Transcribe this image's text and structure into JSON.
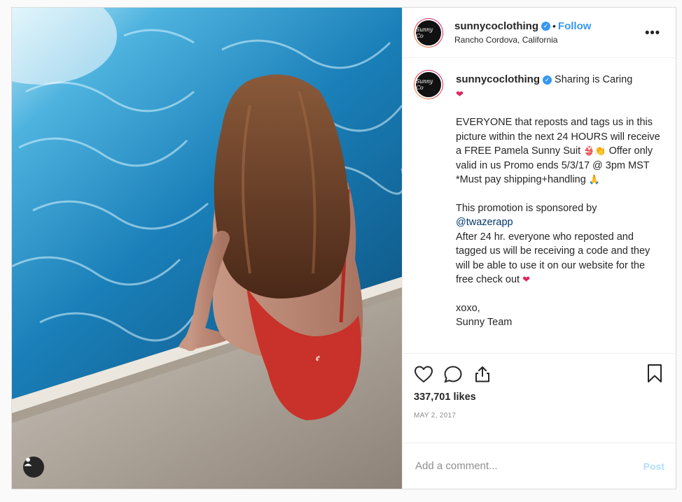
{
  "post": {
    "username": "sunnycoclothing",
    "verified_icon": "verified-badge-icon",
    "follow_label": "Follow",
    "location": "Rancho Cordova, California",
    "avatar_text": "Sunny Co",
    "more_icon": "more-options-icon",
    "more_label": "•••",
    "separator": "•"
  },
  "caption": {
    "first_line": "Sharing is Caring",
    "first_emoji": "❤",
    "para1": "EVERYONE that reposts and tags us in this picture within the next 24 HOURS will receive a FREE Pamela Sunny Suit",
    "para1_emoji": "👙👏",
    "para1_cont": "Offer only valid in us Promo ends 5/3/17 @ 3pm MST *Must pay shipping+handling",
    "para1_end_emoji": "🙏",
    "para2_start": "This promotion is sponsored by",
    "para2_mention": "@twazerapp",
    "para2_rest": "After 24 hr. everyone who reposted and tagged us will be receiving a code and they will be able to use it on our website for the free check out",
    "para2_emoji": "❤",
    "signoff1": "xoxo,",
    "signoff2": "Sunny Team"
  },
  "actions": {
    "icons": [
      "heart-icon",
      "comment-icon",
      "share-icon",
      "bookmark-icon"
    ],
    "likes": "337,701 likes",
    "date": "MAY 2, 2017"
  },
  "comment": {
    "placeholder": "Add a comment...",
    "post_label": "Post"
  },
  "photo": {
    "tag_icon": "user-tag-icon",
    "colors": {
      "water": "#1a7fb8",
      "suit": "#c8322a",
      "hair": "#6b3a22",
      "concrete": "#d8d2c8"
    }
  }
}
